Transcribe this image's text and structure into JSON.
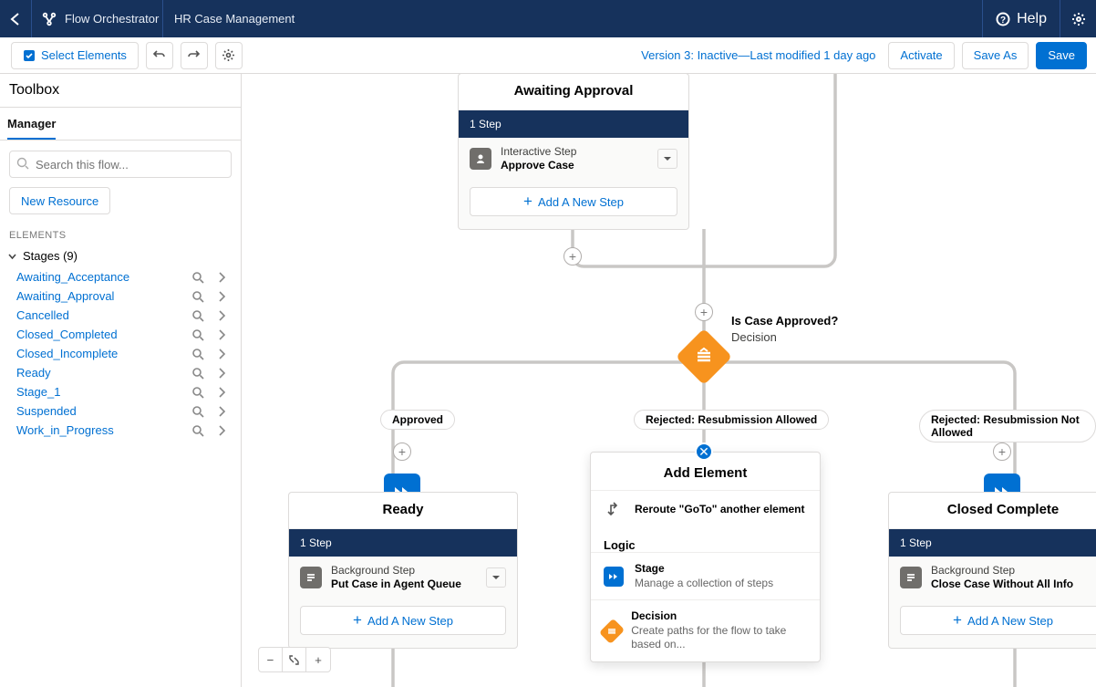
{
  "topnav": {
    "brand": "Flow Orchestrator",
    "context": "HR Case Management",
    "help": "Help"
  },
  "toolbar": {
    "select_elements": "Select Elements",
    "status": "Version 3: Inactive—Last modified 1 day ago",
    "activate": "Activate",
    "save_as": "Save As",
    "save": "Save"
  },
  "sidebar": {
    "title": "Toolbox",
    "active_tab": "Manager",
    "search_placeholder": "Search this flow...",
    "new_resource": "New Resource",
    "elements_header": "ELEMENTS",
    "group_label": "Stages (9)",
    "stages": [
      "Awaiting_Acceptance",
      "Awaiting_Approval",
      "Cancelled",
      "Closed_Completed",
      "Closed_Incomplete",
      "Ready",
      "Stage_1",
      "Suspended",
      "Work_in_Progress"
    ]
  },
  "canvas": {
    "awaiting": {
      "title": "Awaiting Approval",
      "step_count": "1 Step",
      "step_type": "Interactive Step",
      "step_name": "Approve Case",
      "add_step": "Add A New Step"
    },
    "decision": {
      "question": "Is Case Approved?",
      "type": "Decision"
    },
    "branch_labels": {
      "approved": "Approved",
      "rejected_allowed": "Rejected: Resubmission Allowed",
      "rejected_not": "Rejected: Resubmission Not Allowed"
    },
    "ready": {
      "title": "Ready",
      "step_count": "1 Step",
      "step_type": "Background Step",
      "step_name": "Put Case in Agent Queue",
      "add_step": "Add A New Step"
    },
    "closed": {
      "title": "Closed Complete",
      "step_count": "1 Step",
      "step_type": "Background Step",
      "step_name": "Close Case Without All Info",
      "add_step": "Add A New Step"
    }
  },
  "popover": {
    "title": "Add Element",
    "reroute": "Reroute \"GoTo\" another element",
    "logic": "Logic",
    "stage_t": "Stage",
    "stage_d": "Manage a collection of steps",
    "decision_t": "Decision",
    "decision_d": "Create paths for the flow to take based on..."
  },
  "colors": {
    "primary": "#0070d2",
    "nav": "#16325c",
    "orange": "#f7931e"
  }
}
